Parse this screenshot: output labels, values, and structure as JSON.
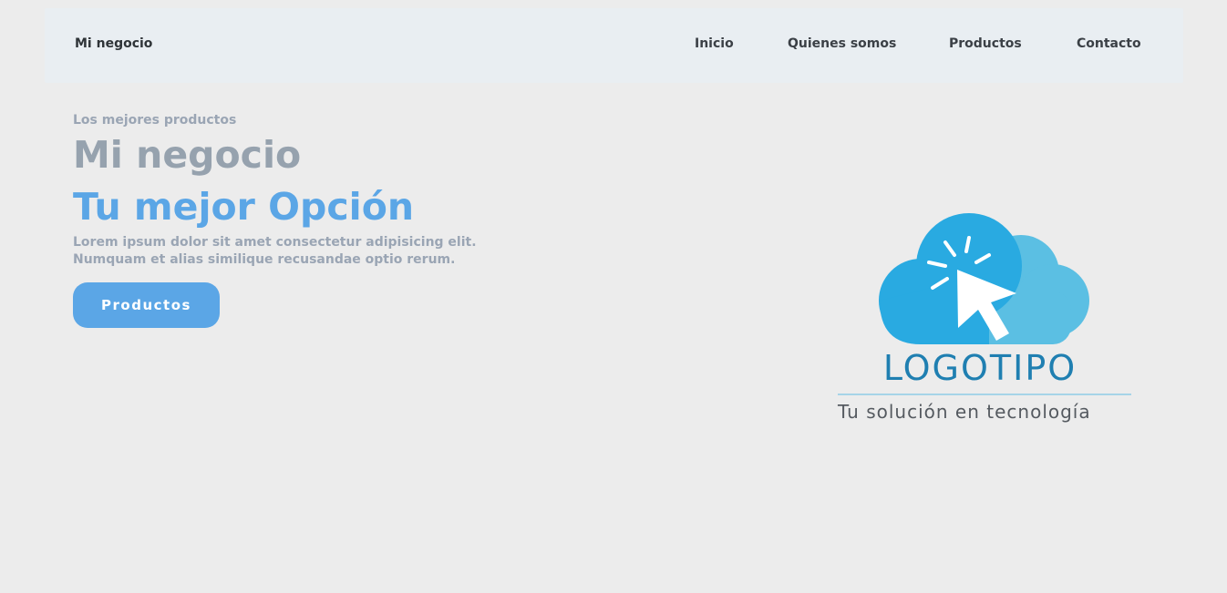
{
  "navbar": {
    "brand": "Mi negocio",
    "links": [
      "Inicio",
      "Quienes somos",
      "Productos",
      "Contacto"
    ]
  },
  "hero": {
    "eyebrow": "Los mejores productos",
    "title_line1": "Mi negocio",
    "title_line2": "Tu mejor Opción",
    "description_line1": "Lorem ipsum dolor sit amet consectetur adipisicing elit.",
    "description_line2": "Numquam et alias similique recusandae optio rerum.",
    "cta_label": "Productos"
  },
  "logo": {
    "wordmark": "LOGOTIPO",
    "tagline": "Tu solución en tecnología",
    "icon": "cloud-cursor-icon"
  },
  "colors": {
    "background": "#ececec",
    "navbar_bg": "#e9eef2",
    "accent": "#5ba6e6",
    "title_gray": "#96a2ae",
    "text_gray": "#9aa5b4",
    "logo_blue_dark": "#1f7fb1",
    "cloud_left": "#29aae1",
    "cloud_right": "#5bbfe3"
  }
}
